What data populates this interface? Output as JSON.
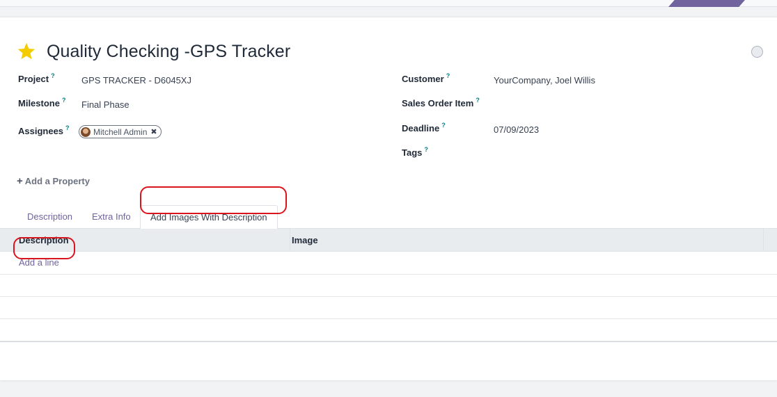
{
  "task": {
    "title": "Quality Checking -GPS Tracker",
    "help_mark": "?"
  },
  "fields": {
    "project": {
      "label": "Project",
      "value": "GPS TRACKER - D6045XJ"
    },
    "milestone": {
      "label": "Milestone",
      "value": "Final Phase"
    },
    "assignees": {
      "label": "Assignees",
      "tag": "Mitchell Admin",
      "remove_glyph": "✖"
    },
    "customer": {
      "label": "Customer",
      "value": "YourCompany, Joel Willis"
    },
    "sales_order_item": {
      "label": "Sales Order Item",
      "value": ""
    },
    "deadline": {
      "label": "Deadline",
      "value": "07/09/2023"
    },
    "tags": {
      "label": "Tags",
      "value": ""
    }
  },
  "add_property": {
    "icon": "plus-icon",
    "glyph": "+",
    "label": "Add a Property"
  },
  "tabs": [
    {
      "label": "Description",
      "active": false
    },
    {
      "label": "Extra Info",
      "active": false
    },
    {
      "label": "Add Images With Description",
      "active": true
    }
  ],
  "table": {
    "columns": [
      "Description",
      "Image"
    ],
    "add_line": "Add a line"
  },
  "colors": {
    "accent": "#71639e",
    "star": "#f3cc00",
    "highlight": "#d8151d"
  },
  "icons": [
    "star-icon",
    "kanban-state-icon",
    "avatar",
    "remove-tag-icon",
    "plus-icon"
  ]
}
